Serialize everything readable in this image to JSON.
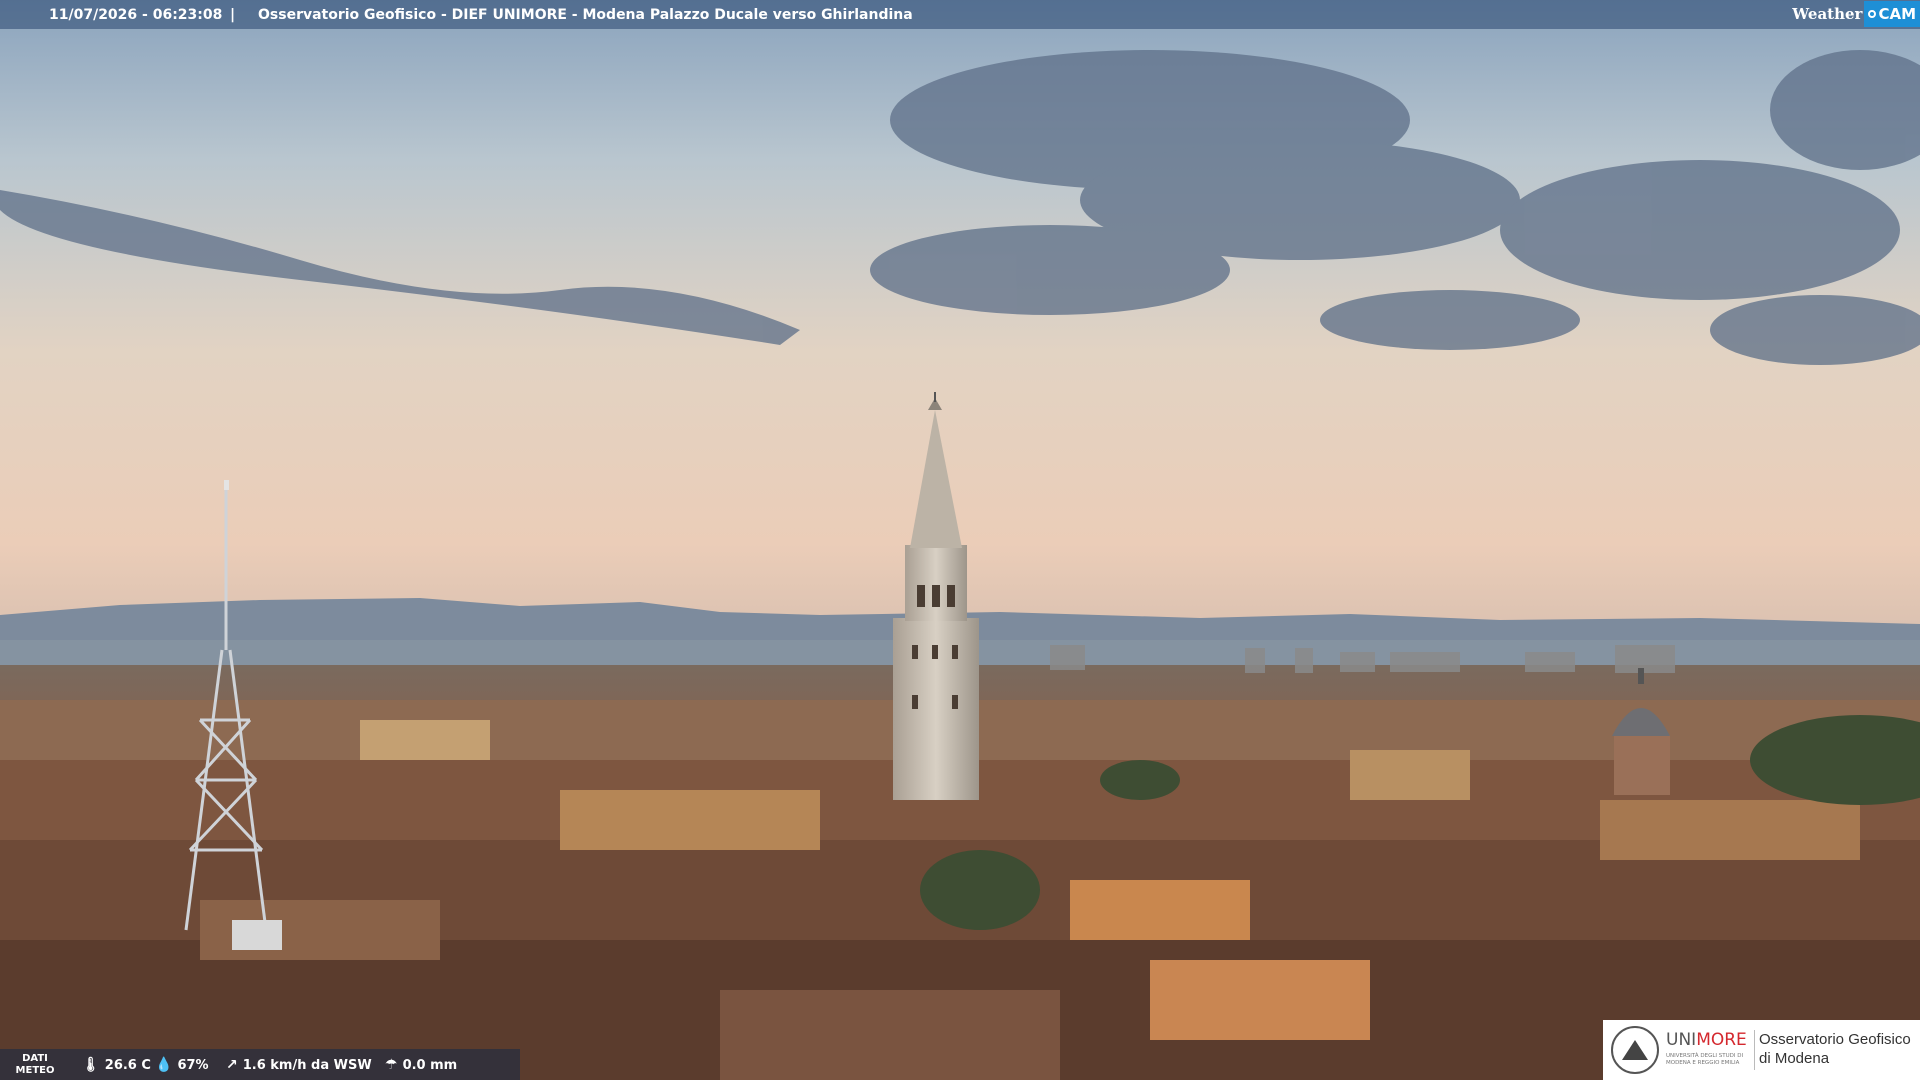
{
  "overlay": {
    "timestamp": "11/07/2026 - 06:23:08",
    "separator": "|",
    "camera_title": "Osservatorio Geofisico - DIEF UNIMORE - Modena Palazzo Ducale verso Ghirlandina",
    "brand_weather": "Weather",
    "brand_cam": "CAM"
  },
  "weather": {
    "label_line1": "DATI",
    "label_line2": "METEO",
    "temperature": "26.6 C",
    "humidity": "67%",
    "wind": "1.6 km/h da WSW",
    "rain": "0.0 mm",
    "icons": [
      "thermometer-icon",
      "humidity-drop-icon",
      "wind-icon",
      "rain-icon"
    ]
  },
  "logo": {
    "uni_part1": "UNI",
    "uni_part2": "MORE",
    "uni_sub": "UNIVERSITÀ DEGLI STUDI DI MODENA E REGGIO EMILIA",
    "observatory_line1": "Osservatorio Geofisico",
    "observatory_line2": "di Modena",
    "accent_color": "#d4282e"
  },
  "scene": {
    "description_colors": {
      "sky_top": "#7c97b5",
      "sky_horizon": "#e8cdb5",
      "roofs": "#7a4c3a",
      "tower": "#c9c0b2"
    }
  }
}
